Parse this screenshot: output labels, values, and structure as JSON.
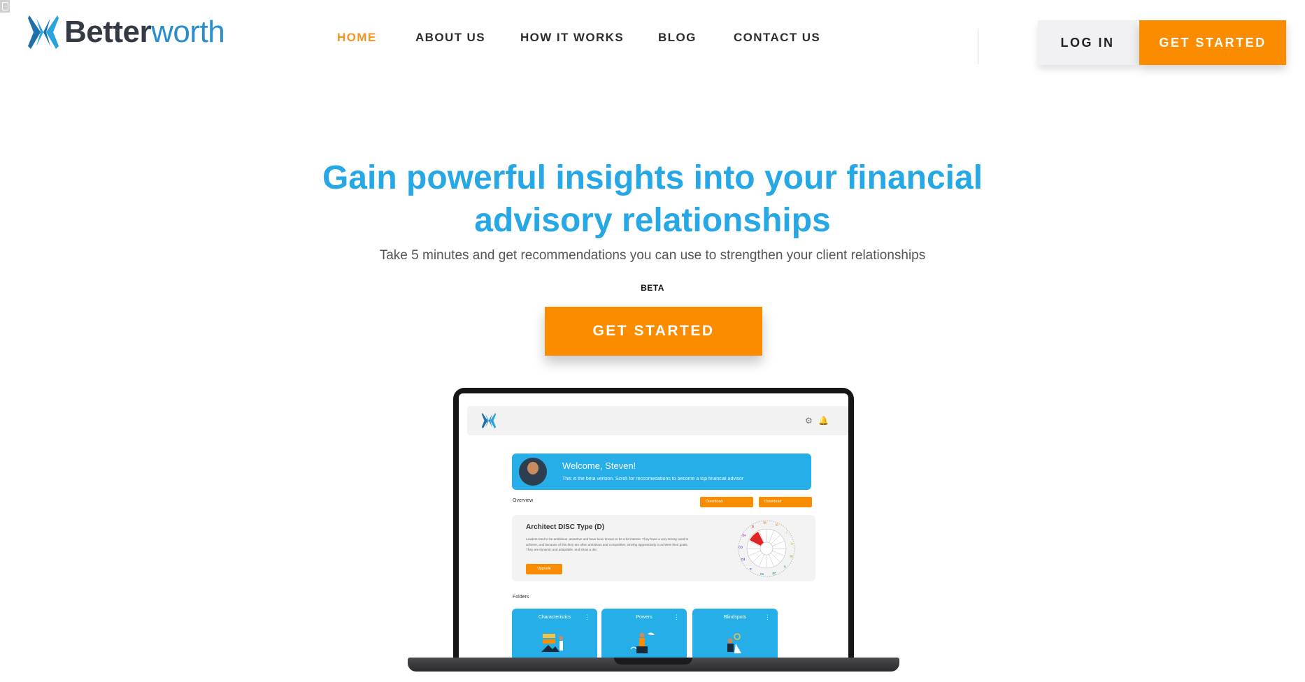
{
  "brand": {
    "name_bold": "Better",
    "name_light": "worth",
    "logo_icon": "butterfly-logo-icon"
  },
  "nav": {
    "items": [
      {
        "label": "HOME",
        "active": true
      },
      {
        "label": "ABOUT US",
        "active": false
      },
      {
        "label": "HOW IT WORKS",
        "active": false
      },
      {
        "label": "BLOG",
        "active": false
      },
      {
        "label": "CONTACT US",
        "active": false
      }
    ],
    "login_label": "LOG IN",
    "get_started_label": "GET STARTED"
  },
  "hero": {
    "title_line1": "Gain powerful insights into your financial",
    "title_line2": "advisory relationships",
    "subtitle": "Take 5 minutes and get recommendations you can use to strengthen your client relationships",
    "badge": "BETA",
    "cta_label": "GET STARTED"
  },
  "app_preview": {
    "top_icons": [
      "gear-icon",
      "bell-icon"
    ],
    "welcome_title": "Welcome, Steven!",
    "welcome_sub": "This is the beta version. Scroll for reccomedations to become a top financial advisor",
    "overview_label": "Overview",
    "download_labels": [
      "Download",
      "Download"
    ],
    "disc_title": "Architect DISC Type (D)",
    "disc_body": "Leaders tend to be ambitious, assertive and have been known to be a bit intense. They have a very strong need to achieve, and because of this they are often ambitious and competitive, striving aggressively to achieve their goals. They are dynamic and adaptable, and show a dec",
    "upgrade_label": "Upgrade",
    "wheel_labels": [
      "D",
      "DI",
      "ID",
      "I",
      "Is",
      "Si",
      "S",
      "SC",
      "Cs",
      "C",
      "Cd",
      "CD",
      "Dc"
    ],
    "folders_label": "Folders",
    "folders": [
      "Characteristics",
      "Powers",
      "Blindspots"
    ]
  },
  "colors": {
    "accent_orange": "#fb8c00",
    "brand_blue": "#26a7e6",
    "logo_dark": "#333a44"
  }
}
